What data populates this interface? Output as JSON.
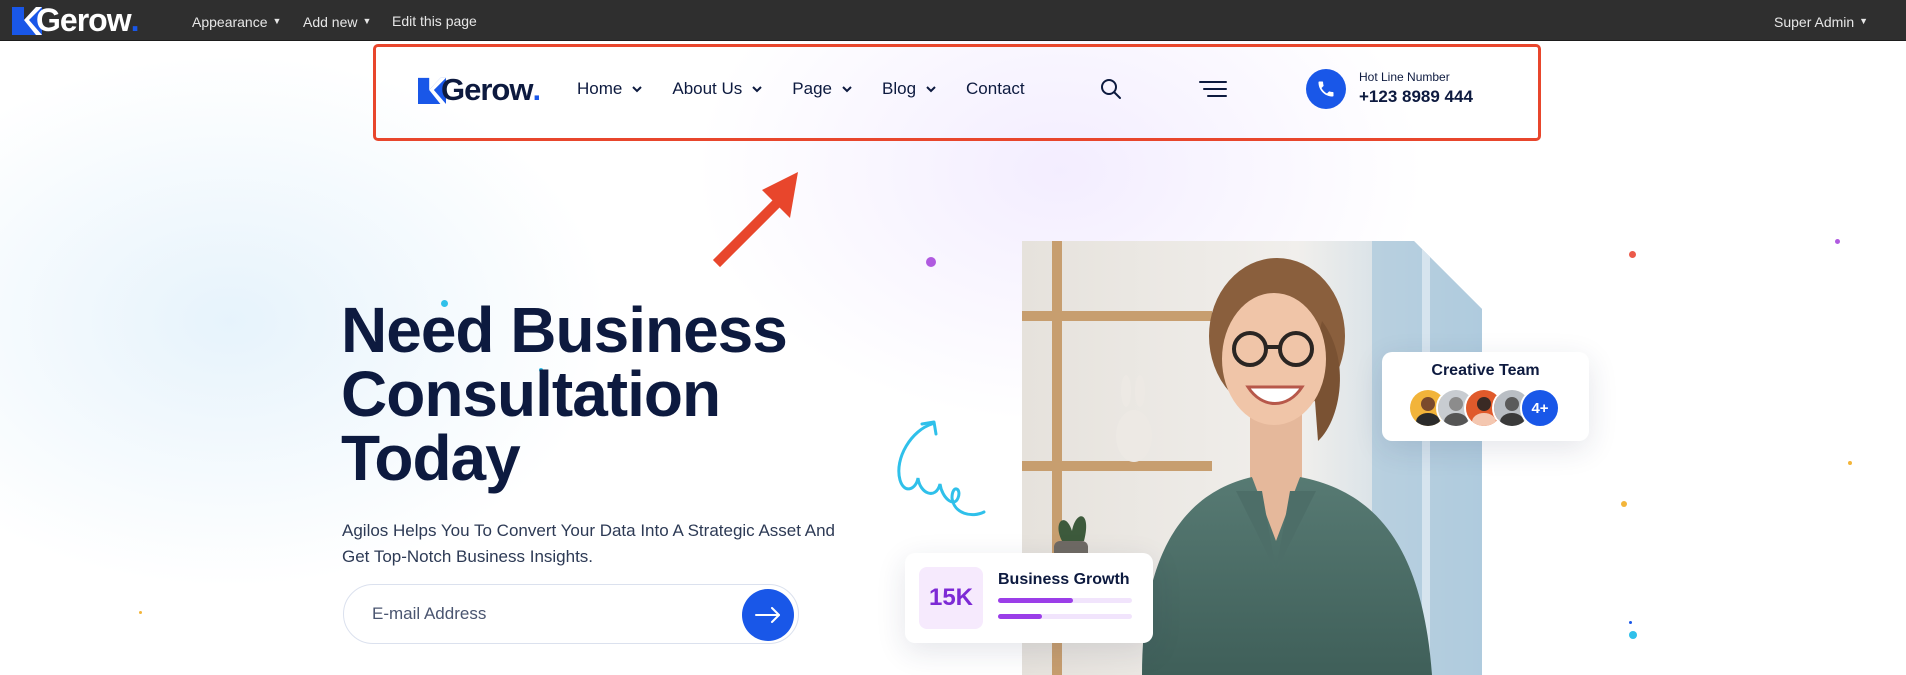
{
  "admin_bar": {
    "logo_text": "Gerow",
    "items": [
      {
        "label": "Appearance"
      },
      {
        "label": "Add new"
      },
      {
        "label": "Edit this page"
      }
    ],
    "user_label": "Super Admin"
  },
  "header": {
    "logo_text": "Gerow",
    "nav": [
      {
        "label": "Home",
        "has_dropdown": true
      },
      {
        "label": "About Us",
        "has_dropdown": true
      },
      {
        "label": "Page",
        "has_dropdown": true
      },
      {
        "label": "Blog",
        "has_dropdown": true
      },
      {
        "label": "Contact",
        "has_dropdown": false
      }
    ],
    "search_icon": "search-icon",
    "menu_icon": "hamburger-icon",
    "hotline_label": "Hot Line Number",
    "hotline_number": "+123 8989 444"
  },
  "hero": {
    "title_lines": [
      "Need Business",
      "Consultation",
      "Today"
    ],
    "description": "Agilos Helps You To Convert Your Data Into A Strategic Asset And Get Top-Notch Business Insights.",
    "email_placeholder": "E-mail Address",
    "submit_icon": "arrow-right-icon"
  },
  "team_card": {
    "title": "Creative Team",
    "more_label": "4+"
  },
  "growth_card": {
    "stat": "15K",
    "title": "Business Growth",
    "bars": [
      0.56,
      0.33
    ]
  },
  "colors": {
    "brand_blue": "#1957e8",
    "navy": "#0d1a3f",
    "purple": "#9b3ee8",
    "highlight": "#e8462c",
    "admin_bar": "#2f2f2f"
  }
}
